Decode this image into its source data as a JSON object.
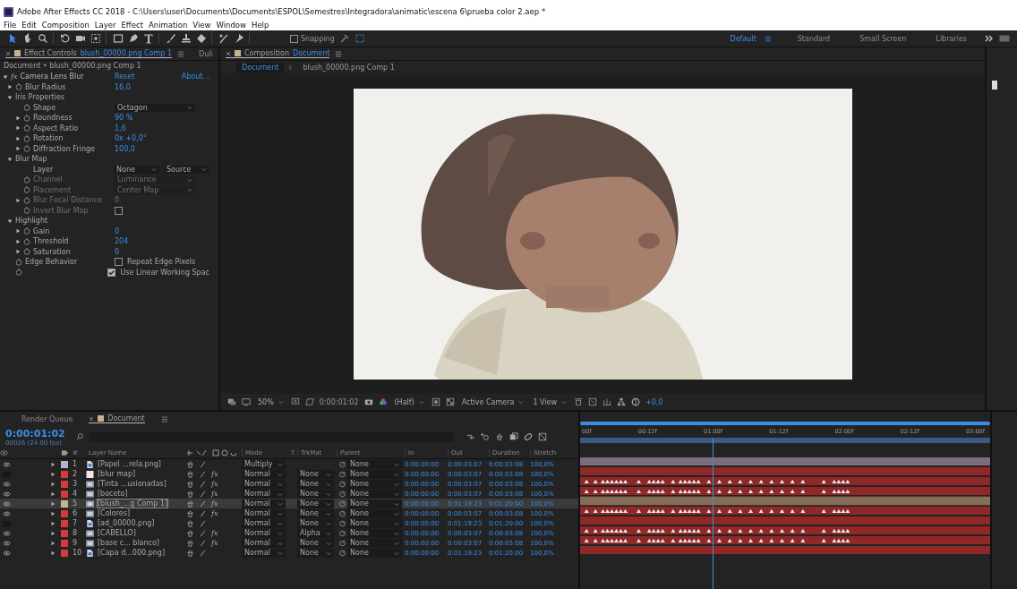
{
  "window": {
    "title": "Adobe After Effects CC 2018 - C:\\Users\\user\\Documents\\Documents\\ESPOL\\Semestres\\Integradora\\animatic\\escena 6\\prueba color 2.aep *"
  },
  "menu": [
    "File",
    "Edit",
    "Composition",
    "Layer",
    "Effect",
    "Animation",
    "View",
    "Window",
    "Help"
  ],
  "toolbar": {
    "snapping": {
      "label": "Snapping",
      "checked": false
    }
  },
  "workspaces": [
    {
      "label": "Default",
      "selected": true
    },
    {
      "label": "Standard",
      "selected": false
    },
    {
      "label": "Small Screen",
      "selected": false
    },
    {
      "label": "Libraries",
      "selected": false
    }
  ],
  "effect_controls": {
    "tabs": [
      {
        "label": "Effect Controls",
        "link": "blush_00000.png Comp 1",
        "selected": true
      },
      {
        "label": "Duli",
        "selected": false
      }
    ],
    "breadcrumb": "Document • blush_00000.png Comp 1",
    "effect": {
      "badge": "fx",
      "name": "Camera Lens Blur",
      "reset": "Reset",
      "about": "About...",
      "expanded": true
    },
    "properties": [
      {
        "label": "Blur Radius",
        "kind": "number",
        "value": "16,0",
        "expanded": false,
        "stopwatch": true
      },
      {
        "label": "Iris Properties",
        "kind": "group",
        "expanded": true,
        "children": [
          {
            "label": "Shape",
            "kind": "dropdown",
            "value": "Octagon",
            "stopwatch": true
          },
          {
            "label": "Roundness",
            "kind": "number",
            "value": "90 %",
            "expanded": false,
            "stopwatch": true
          },
          {
            "label": "Aspect Ratio",
            "kind": "number",
            "value": "1,6",
            "expanded": false,
            "stopwatch": true
          },
          {
            "label": "Rotation",
            "kind": "number",
            "value": "0x +0,0°",
            "expanded": false,
            "stopwatch": true
          },
          {
            "label": "Diffraction Fringe",
            "kind": "number",
            "value": "100,0",
            "expanded": false,
            "stopwatch": true
          }
        ]
      },
      {
        "label": "Blur Map",
        "kind": "group",
        "expanded": true,
        "children": [
          {
            "label": "Layer",
            "kind": "dropdowns",
            "values": [
              "None",
              "Source"
            ]
          },
          {
            "label": "Channel",
            "kind": "dropdown",
            "value": "Luminance",
            "stopwatch": true,
            "disabled": true
          },
          {
            "label": "Placement",
            "kind": "dropdown",
            "value": "Center Map",
            "stopwatch": true,
            "disabled": true
          },
          {
            "label": "Blur Focal Distance",
            "kind": "number",
            "value": "0",
            "expanded": false,
            "stopwatch": true,
            "disabled": true
          },
          {
            "label": "Invert Blur Map",
            "kind": "checkbox",
            "checked": false,
            "stopwatch": true,
            "disabled": true
          }
        ]
      },
      {
        "label": "Highlight",
        "kind": "group",
        "expanded": true,
        "children": [
          {
            "label": "Gain",
            "kind": "number",
            "value": "0",
            "expanded": false,
            "stopwatch": true
          },
          {
            "label": "Threshold",
            "kind": "number",
            "value": "204",
            "expanded": false,
            "stopwatch": true
          },
          {
            "label": "Saturation",
            "kind": "number",
            "value": "0",
            "expanded": false,
            "stopwatch": true
          }
        ]
      },
      {
        "label": "Edge Behavior",
        "kind": "checkbox",
        "text": "Repeat Edge Pixels",
        "checked": false,
        "stopwatch": true
      },
      {
        "kind": "checkbox",
        "text": "Use Linear Working Spac",
        "checked": true,
        "stopwatch": true
      }
    ]
  },
  "composition": {
    "tab": {
      "label": "Composition",
      "link": "Document",
      "selected": true
    },
    "breadcrumbs": [
      {
        "label": "Document",
        "selected": true
      },
      {
        "label": "blush_00000.png Comp 1",
        "selected": false
      }
    ],
    "viewer_bar": {
      "zoom": "50%",
      "timecode": "0:00:01:02",
      "resolution": "(Half)",
      "camera": "Active Camera",
      "views": "1 View",
      "exposure": "+0,0"
    }
  },
  "timeline": {
    "tabs": [
      {
        "label": "Render Queue",
        "selected": false
      },
      {
        "label": "Document",
        "selected": true
      }
    ],
    "timecode": "0:00:01:02",
    "frame": "00026 (24.00 fps)",
    "columns": {
      "number": "#",
      "name": "Layer Name",
      "mode": "Mode",
      "t": "T",
      "trkmat": "TrkMat",
      "parent": "Parent",
      "in": "In",
      "out": "Out",
      "duration": "Duration",
      "stretch": "Stretch"
    },
    "ruler": [
      "00f",
      "00:12f",
      "01:00f",
      "01:12f",
      "02:00f",
      "02:12f",
      "03:00f"
    ],
    "layers": [
      {
        "number": "1",
        "color": "#b3b2d8",
        "name": "[Papel ...rela.png]",
        "kind": "file",
        "visible": true,
        "mode": "Multiply",
        "parent": "None",
        "in": "0:00:00:00",
        "out": "0:00:03:07",
        "duration": "0:00:03:08",
        "stretch": "100,0%",
        "selected": false,
        "keyframes": false
      },
      {
        "number": "2",
        "color": "#d63a3a",
        "name": "[blur map]",
        "kind": "solid",
        "visible": false,
        "fx": "fx",
        "mode": "Normal",
        "trkmat": "None",
        "parent": "None",
        "in": "0:00:00:00",
        "out": "0:00:03:07",
        "duration": "0:00:03:08",
        "stretch": "100,0%",
        "selected": false,
        "keyframes": false
      },
      {
        "number": "3",
        "color": "#d63a3a",
        "name": "[Tinta ...usionadas]",
        "kind": "comp",
        "visible": true,
        "fx": "fx",
        "mode": "Normal",
        "trkmat": "None",
        "parent": "None",
        "in": "0:00:00:00",
        "out": "0:00:03:07",
        "duration": "0:00:03:08",
        "stretch": "100,0%",
        "selected": false,
        "keyframes": true
      },
      {
        "number": "4",
        "color": "#d63a3a",
        "name": "[boceto]",
        "kind": "comp",
        "visible": true,
        "fx": "fx",
        "mode": "Normal",
        "trkmat": "None",
        "parent": "None",
        "in": "0:00:00:00",
        "out": "0:00:03:07",
        "duration": "0:00:03:08",
        "stretch": "100,0%",
        "selected": false,
        "keyframes": true
      },
      {
        "number": "5",
        "color": "#c6b48c",
        "name": "[blush_...g Comp 1]",
        "kind": "comp",
        "visible": true,
        "fx": "fx",
        "mode": "Normal",
        "trkmat": "None",
        "parent": "None",
        "in": "0:00:00:00",
        "out": "0:01:19:23",
        "duration": "0:01:20:00",
        "stretch": "100,0%",
        "selected": true,
        "keyframes": false
      },
      {
        "number": "6",
        "color": "#d63a3a",
        "name": "[Colores]",
        "kind": "comp",
        "visible": true,
        "fx": "fx",
        "mode": "Normal",
        "trkmat": "None",
        "parent": "None",
        "in": "0:00:00:00",
        "out": "0:00:03:07",
        "duration": "0:00:03:08",
        "stretch": "100,0%",
        "selected": false,
        "keyframes": true
      },
      {
        "number": "7",
        "color": "#d63a3a",
        "name": "[ad_00000.png]",
        "kind": "file",
        "visible": false,
        "mode": "Normal",
        "trkmat": "None",
        "parent": "None",
        "in": "0:00:00:00",
        "out": "0:01:19:23",
        "duration": "0:01:20:00",
        "stretch": "100,0%",
        "selected": false,
        "keyframes": false
      },
      {
        "number": "8",
        "color": "#d63a3a",
        "name": "[CABELLO]",
        "kind": "comp",
        "visible": true,
        "fx": "fx",
        "mode": "Normal",
        "trkmat": "Alpha",
        "parent": "None",
        "in": "0:00:00:00",
        "out": "0:00:03:07",
        "duration": "0:00:03:08",
        "stretch": "100,0%",
        "selected": false,
        "keyframes": true
      },
      {
        "number": "9",
        "color": "#d63a3a",
        "name": "[base c... blanco]",
        "kind": "comp",
        "visible": true,
        "fx": "fx",
        "mode": "Normal",
        "trkmat": "None",
        "parent": "None",
        "in": "0:00:00:00",
        "out": "0:00:03:07",
        "duration": "0:00:03:08",
        "stretch": "100,0%",
        "selected": false,
        "keyframes": true
      },
      {
        "number": "10",
        "color": "#d63a3a",
        "name": "[Capa d...000.png]",
        "kind": "file",
        "visible": true,
        "mode": "Normal",
        "trkmat": "None",
        "parent": "None",
        "in": "0:00:00:00",
        "out": "0:01:19:23",
        "duration": "0:01:20:00",
        "stretch": "100,0%",
        "selected": false,
        "keyframes": false
      }
    ]
  }
}
